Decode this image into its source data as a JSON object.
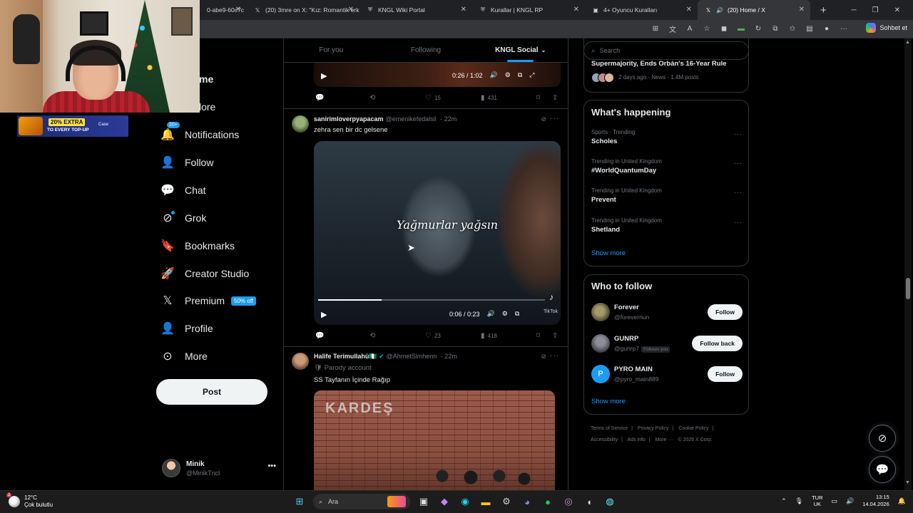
{
  "browser": {
    "tabs": [
      {
        "label": "0-abe9-60c7c",
        "icon": "x-icon"
      },
      {
        "label": "(20) 3mre on X: \"Kız: Romantik erk",
        "icon": "x-icon"
      },
      {
        "label": "KNGL Wiki Portal",
        "icon": "shield-icon"
      },
      {
        "label": "Kurallar | KNGL RP",
        "icon": "shield-icon"
      },
      {
        "label": "4+ Oyuncu Kuralları",
        "icon": "doc-icon"
      },
      {
        "label": "(20) Home / X",
        "icon": "x-icon",
        "active": true
      }
    ],
    "copilot_label": "Sohbet et"
  },
  "feed": {
    "tabs": [
      "For you",
      "Following",
      "KNGL Social"
    ],
    "active_tab": "KNGL Social",
    "tweet1": {
      "video_time": "0:26 / 1:02",
      "stats": {
        "likes": "15",
        "views": "431"
      }
    },
    "tweet2": {
      "display_name": "sanirimloverpyapacam",
      "handle": "@emenikefedalsil",
      "time": "· 22m",
      "text": "zehra sen bir dc gelsene",
      "video_caption": "Yağmurlar yağsın",
      "video_time": "0:06 / 0:23",
      "video_progress": 0.28,
      "watermark": "TikTok",
      "stats": {
        "likes": "23",
        "views": "418"
      }
    },
    "tweet3": {
      "display_name": "Halife Terimullahü🇳🇬",
      "handle": "@AhmetSlmhenn",
      "time": "· 22m",
      "parody": "Parody account",
      "text": "SS Tayfanın İçinde Rağıp",
      "image_sign": "KARDEŞ"
    }
  },
  "nav": {
    "items": [
      {
        "id": "home",
        "label": "Home",
        "icon": "home-icon"
      },
      {
        "id": "explore",
        "label": "Explore",
        "icon": "search-icon"
      },
      {
        "id": "notifications",
        "label": "Notifications",
        "icon": "bell-icon",
        "badge": "20+"
      },
      {
        "id": "follow",
        "label": "Follow",
        "icon": "person-add-icon"
      },
      {
        "id": "chat",
        "label": "Chat",
        "icon": "chat-icon"
      },
      {
        "id": "grok",
        "label": "Grok",
        "icon": "grok-icon"
      },
      {
        "id": "bookmarks",
        "label": "Bookmarks",
        "icon": "bookmark-icon"
      },
      {
        "id": "creator",
        "label": "Creator Studio",
        "icon": "rocket-icon"
      },
      {
        "id": "premium",
        "label": "Premium",
        "icon": "x-logo-icon",
        "badge": "50% off"
      },
      {
        "id": "profile",
        "label": "Profile",
        "icon": "person-icon"
      },
      {
        "id": "more",
        "label": "More",
        "icon": "more-circle-icon"
      }
    ],
    "home_partial": "me",
    "explore_partial": "lore",
    "post_label": "Post",
    "account": {
      "name": "Minik",
      "handle": "@MinikTncl"
    }
  },
  "sidebar": {
    "search_placeholder": "Search",
    "top_news": {
      "title": "Supermajority, Ends Orbán's 16-Year Rule",
      "meta": "2 days ago · News · 1.4M posts"
    },
    "happening": {
      "title": "What's happening",
      "trends": [
        {
          "context": "Sports · Trending",
          "name": "Scholes"
        },
        {
          "context": "Trending in United Kingdom",
          "name": "#WorldQuantumDay"
        },
        {
          "context": "Trending in United Kingdom",
          "name": "Prevent"
        },
        {
          "context": "Trending in United Kingdom",
          "name": "Shetland"
        }
      ],
      "show_more": "Show more"
    },
    "who_to_follow": {
      "title": "Who to follow",
      "accounts": [
        {
          "name": "Forever",
          "handle": "@forevernun",
          "button": "Follow"
        },
        {
          "name": "GUNRP",
          "handle": "@gunrp7",
          "follows_you": "Follows you",
          "button": "Follow back"
        },
        {
          "name": "PYRO MAIN",
          "handle": "@pyro_main889",
          "button": "Follow",
          "initial": "P"
        }
      ],
      "show_more": "Show more"
    },
    "footer": [
      "Terms of Service",
      "|",
      "Privacy Policy",
      "|",
      "Cookie Policy",
      "|",
      "Accessibility",
      "|",
      "Ads info",
      "|",
      "More ···",
      "© 2026 X Corp."
    ]
  },
  "overlay": {
    "promo_line1": "20% EXTRA",
    "promo_line2": "TO EVERY TOP-UP",
    "promo_brand": "Case"
  },
  "taskbar": {
    "weather_temp": "12°C",
    "weather_desc": "Çok bulutlu",
    "weather_badge": "2",
    "search_label": "Ara",
    "lang_top": "TUR",
    "lang_bottom": "UK",
    "time": "13:15",
    "date": "14.04.2026"
  },
  "colors": {
    "accent": "#1d9bf0",
    "background": "#000000",
    "border": "#2f3336",
    "muted": "#71767b"
  }
}
